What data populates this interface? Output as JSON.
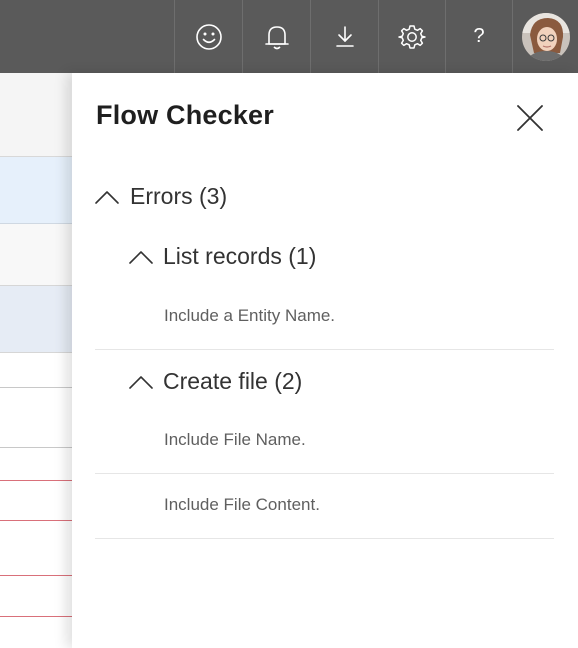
{
  "topbar": {
    "icons": [
      "smiley-icon",
      "bell-icon",
      "download-icon",
      "gear-icon"
    ],
    "help_label": "?",
    "colors": {
      "background": "#5a5a5a",
      "icon": "#ffffff"
    }
  },
  "panel": {
    "title": "Flow Checker",
    "close_icon": "close-icon",
    "errors": {
      "label": "Errors (3)",
      "groups": [
        {
          "label": "List records (1)",
          "items": [
            "Include a Entity Name."
          ]
        },
        {
          "label": "Create file (2)",
          "items": [
            "Include File Name.",
            "Include File Content."
          ]
        }
      ]
    }
  }
}
